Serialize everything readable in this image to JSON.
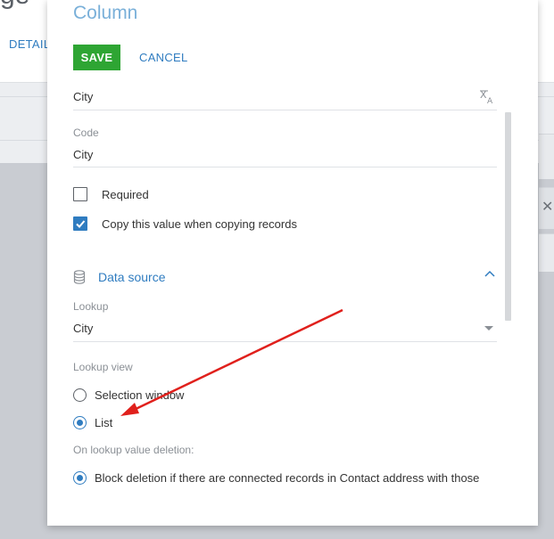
{
  "background": {
    "page_title": "ge",
    "tab_label": "DETAIL",
    "close_glyph": "✕"
  },
  "modal": {
    "title": "Column",
    "save_label": "SAVE",
    "cancel_label": "CANCEL",
    "title_field": {
      "value": "City",
      "icon": "translate-icon"
    },
    "code_field": {
      "label": "Code",
      "value": "City"
    },
    "checkboxes": [
      {
        "label": "Required",
        "checked": false
      },
      {
        "label": "Copy this value when copying records",
        "checked": true
      }
    ],
    "data_source": {
      "title": "Data source",
      "icon": "database-icon",
      "lookup_label": "Lookup",
      "lookup_value": "City",
      "lookup_view_label": "Lookup view",
      "options": [
        {
          "label": "Selection window",
          "selected": false
        },
        {
          "label": "List",
          "selected": true
        }
      ],
      "deletion_label": "On lookup value deletion:",
      "deletion_option": {
        "label": "Block deletion if there are connected records in Contact address with those",
        "selected": true
      }
    }
  },
  "annotation": {
    "color": "#e0201c"
  },
  "colors": {
    "accent": "#2f7cc0",
    "save": "#2ea533"
  }
}
